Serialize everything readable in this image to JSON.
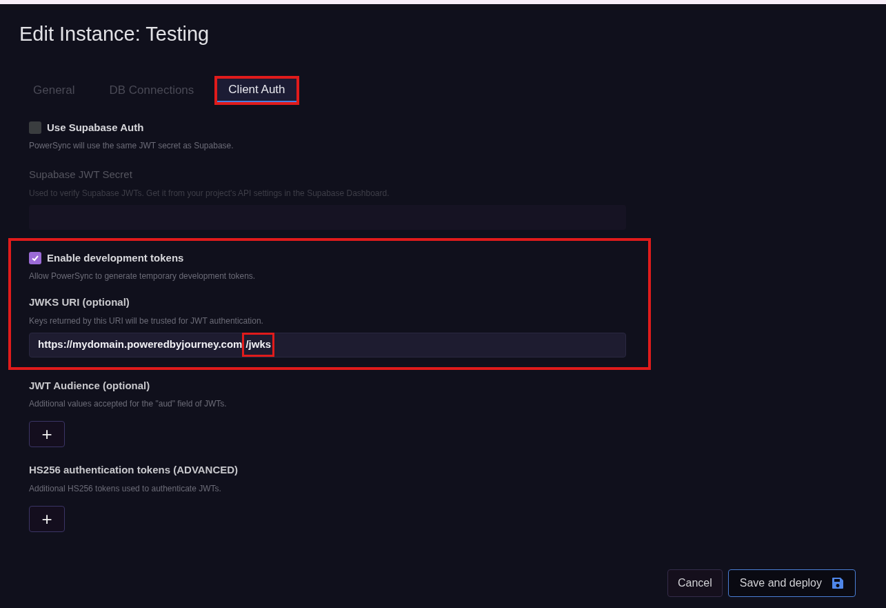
{
  "title": "Edit Instance: Testing",
  "tabs": [
    {
      "label": "General",
      "selected": false,
      "highlighted": false
    },
    {
      "label": "DB Connections",
      "selected": false,
      "highlighted": false
    },
    {
      "label": "Client Auth",
      "selected": true,
      "highlighted": true
    }
  ],
  "groups": [
    {
      "highlighted": false,
      "sections": [
        {
          "kind": "checkbox",
          "label": "Use Supabase Auth",
          "description": "PowerSync will use the same JWT secret as Supabase.",
          "checked": false
        },
        {
          "kind": "field",
          "label": "Supabase JWT Secret",
          "description": "Used to verify Supabase JWTs. Get it from your project's API settings in the Supabase Dashboard.",
          "disabled": true
        }
      ]
    },
    {
      "highlighted": true,
      "sections": [
        {
          "kind": "checkbox",
          "label": "Enable development tokens",
          "description": "Allow PowerSync to generate temporary development tokens.",
          "checked": true
        },
        {
          "kind": "field",
          "label": "JWKS URI (optional)",
          "description": "Keys returned by this URI will be trusted for JWT authentication.",
          "disabled": false,
          "value": "https://mydomain.poweredbyjourney.com",
          "value_marked": "/jwks"
        }
      ]
    },
    {
      "highlighted": false,
      "sections": [
        {
          "kind": "list",
          "label": "JWT Audience (optional)",
          "description": "Additional values accepted for the \"aud\" field of JWTs.",
          "add_label": "+"
        },
        {
          "kind": "list",
          "label": "HS256 authentication tokens (ADVANCED)",
          "description": "Additional HS256 tokens used to authenticate JWTs.",
          "add_label": "+"
        }
      ]
    }
  ],
  "buttons": [
    {
      "kind": "secondary",
      "label": "Cancel"
    },
    {
      "kind": "primary",
      "label": "Save and deploy"
    }
  ]
}
